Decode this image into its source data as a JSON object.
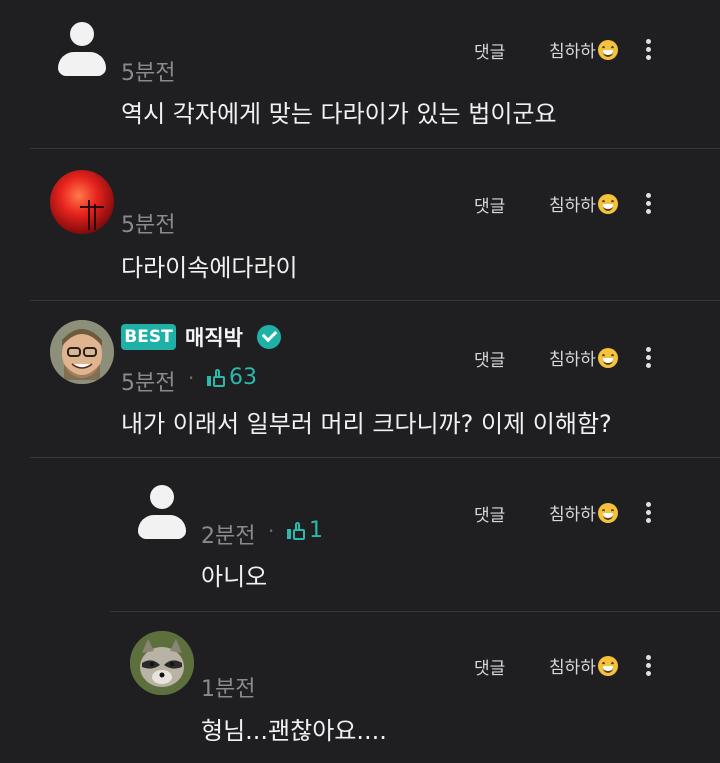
{
  "labels": {
    "reply": "댓글",
    "react": "침하하"
  },
  "comments": [
    {
      "time": "5분전",
      "text": "역시 각자에게 맞는 다라이가 있는 법이군요",
      "avatar": "default-avatar"
    },
    {
      "time": "5분전",
      "text": "다라이속에다라이",
      "avatar": "red-photo-avatar"
    },
    {
      "time": "5분전",
      "text": "내가 이래서 일부러 머리 크다니까? 이제 이해함?",
      "avatar": "man-photo-avatar",
      "badge": "BEST",
      "nickname": "매직박",
      "likes": "63"
    },
    {
      "time": "2분전",
      "text": "아니오",
      "avatar": "default-avatar",
      "likes": "1"
    },
    {
      "time": "1분전",
      "text": "형님...괜찮아요....",
      "avatar": "raccoon-avatar"
    }
  ],
  "colors": {
    "background": "#1f1f21",
    "accent": "#1fb1a8",
    "divider": "#36363a"
  }
}
